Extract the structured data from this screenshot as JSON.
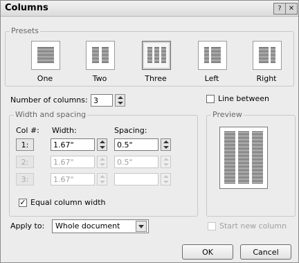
{
  "window": {
    "title": "Columns",
    "help_label": "?",
    "close_label": "✕"
  },
  "presets": {
    "label": "Presets",
    "items": [
      {
        "label": "One",
        "columns": 1
      },
      {
        "label": "Two",
        "columns": 2
      },
      {
        "label": "Three",
        "columns": 3,
        "selected": true
      },
      {
        "label": "Left",
        "columns": 2
      },
      {
        "label": "Right",
        "columns": 2
      }
    ]
  },
  "number_of_columns": {
    "label": "Number of columns:",
    "value": "3"
  },
  "line_between": {
    "label": "Line between",
    "checked": false
  },
  "width_spacing": {
    "label": "Width and spacing",
    "col_header": "Col #:",
    "width_header": "Width:",
    "spacing_header": "Spacing:",
    "rows": [
      {
        "col": "1:",
        "width": "1.67\"",
        "spacing": "0.5\""
      },
      {
        "col": "2:",
        "width": "1.67\"",
        "spacing": "0.5\""
      },
      {
        "col": "3:",
        "width": "1.67\"",
        "spacing": ""
      }
    ]
  },
  "equal_width": {
    "label": "Equal column width",
    "checked": true
  },
  "preview": {
    "label": "Preview"
  },
  "apply_to": {
    "label": "Apply to:",
    "value": "Whole document"
  },
  "start_new_column": {
    "label": "Start new column",
    "checked": false
  },
  "buttons": {
    "ok": "OK",
    "cancel": "Cancel"
  }
}
